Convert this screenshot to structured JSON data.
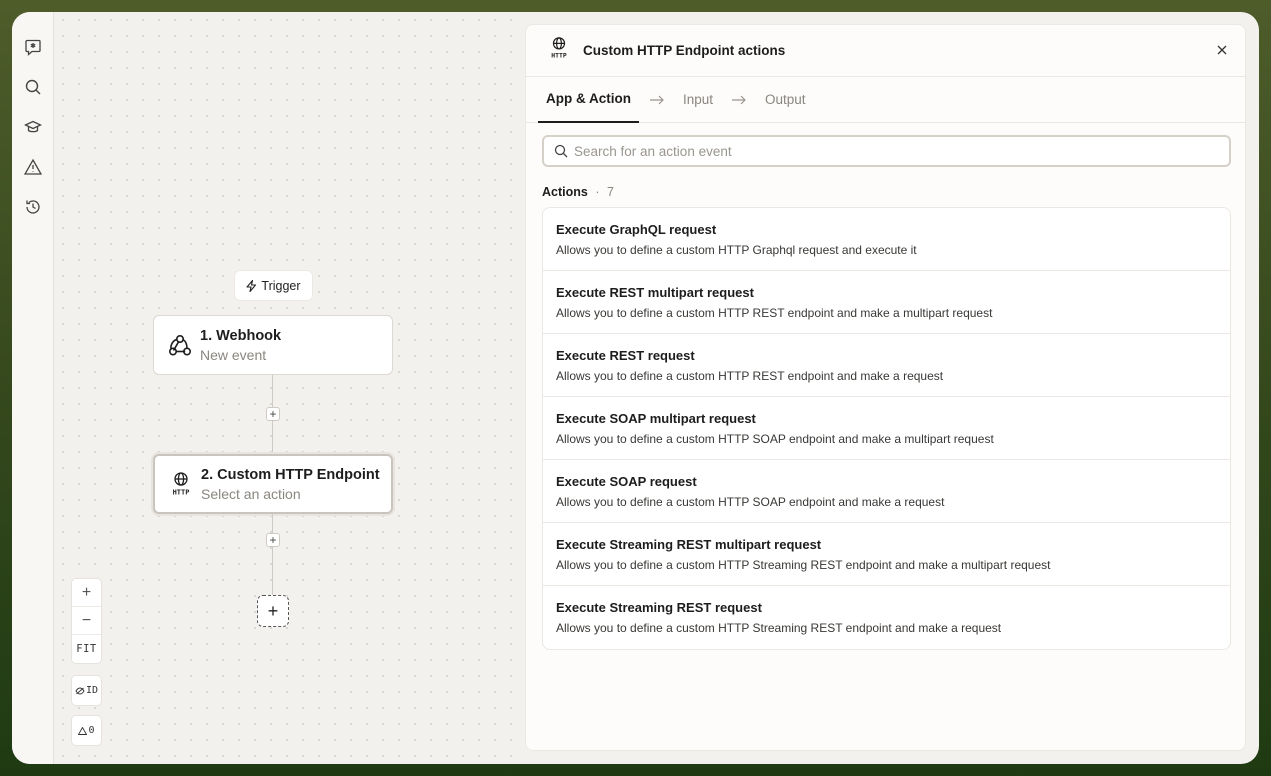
{
  "canvas": {
    "trigger_label": "Trigger",
    "nodes": [
      {
        "title": "1. Webhook",
        "subtitle": "New event"
      },
      {
        "title": "2. Custom HTTP Endpoint",
        "subtitle": "Select an action"
      }
    ],
    "zoom_in": "+",
    "zoom_out": "−",
    "fit_label": "FIT",
    "id_toggle_label": "ID",
    "warnings_count": "0"
  },
  "panel": {
    "title": "Custom HTTP Endpoint actions",
    "tabs": [
      {
        "label": "App & Action",
        "active": true
      },
      {
        "label": "Input",
        "active": false
      },
      {
        "label": "Output",
        "active": false
      }
    ],
    "search_placeholder": "Search for an action event",
    "actions_label": "Actions",
    "actions_separator": "·",
    "actions_count": "7",
    "actions": [
      {
        "title": "Execute GraphQL request",
        "description": "Allows you to define a custom HTTP Graphql request and execute it"
      },
      {
        "title": "Execute REST multipart request",
        "description": "Allows you to define a custom HTTP REST endpoint and make a multipart request"
      },
      {
        "title": "Execute REST request",
        "description": "Allows you to define a custom HTTP REST endpoint and make a request"
      },
      {
        "title": "Execute SOAP multipart request",
        "description": "Allows you to define a custom HTTP SOAP endpoint and make a multipart request"
      },
      {
        "title": "Execute SOAP request",
        "description": "Allows you to define a custom HTTP SOAP endpoint and make a request"
      },
      {
        "title": "Execute Streaming REST multipart request",
        "description": "Allows you to define a custom HTTP Streaming REST endpoint and make a multipart request"
      },
      {
        "title": "Execute Streaming REST request",
        "description": "Allows you to define a custom HTTP Streaming REST endpoint and make a request"
      }
    ]
  },
  "icons": {
    "rail": [
      "chat-sparkle-icon",
      "search-icon",
      "graduation-cap-icon",
      "warning-icon",
      "history-icon"
    ],
    "node1": "webhook-icon",
    "node2": "http-globe-icon"
  },
  "colors": {
    "frame_outer": "#33471c",
    "canvas_bg": "#f3f1ee",
    "panel_bg": "#fdfcfa",
    "text_primary": "#1d1d1d",
    "text_muted": "#8a8680"
  }
}
